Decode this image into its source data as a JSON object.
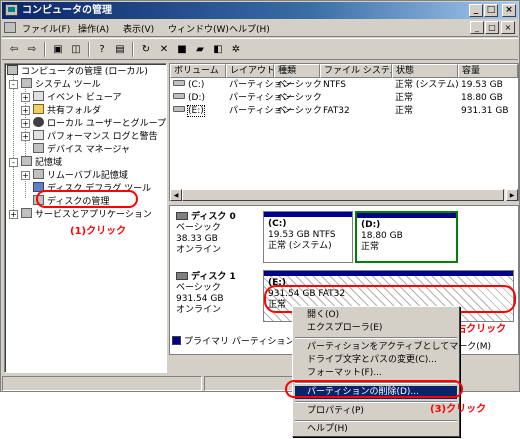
{
  "window": {
    "title": "コンピュータの管理"
  },
  "titlebar_buttons": [
    "_",
    "□",
    "×"
  ],
  "menubar": {
    "items": [
      "ファイル(F)",
      "操作(A)",
      "表示(V)",
      "ウィンドウ(W)",
      "ヘルプ(H)"
    ],
    "mdi_buttons": [
      "_",
      "□",
      "×"
    ]
  },
  "toolbar": {
    "icons": [
      "back-arrow-icon",
      "forward-arrow-icon",
      "up-folder-icon",
      "show-tree-icon",
      "help-icon",
      "properties-icon",
      "refresh-icon",
      "delete-icon",
      "open-icon",
      "folder-icon",
      "drive-icon",
      "settings-icon"
    ]
  },
  "tree": {
    "root": "コンピュータの管理 (ローカル)",
    "system_tools": "システム ツール",
    "event_viewer": "イベント ビューア",
    "shared_folders": "共有フォルダ",
    "local_users": "ローカル ユーザーとグループ",
    "perf_logs": "パフォーマンス ログと警告",
    "device_manager": "デバイス マネージャ",
    "storage": "記憶域",
    "removable": "リムーバブル記憶域",
    "defrag": "ディスク デフラグ ツール",
    "disk_mgmt": "ディスクの管理",
    "services_apps": "サービスとアプリケーション",
    "expander_plus": "+",
    "expander_minus": "-"
  },
  "volumes": {
    "columns": [
      "ボリューム",
      "レイアウト",
      "種類",
      "ファイル システム",
      "状態",
      "容量"
    ],
    "rows": [
      [
        "(C:)",
        "パーティション",
        "ベーシック",
        "NTFS",
        "正常 (システム)",
        "19.53 GB"
      ],
      [
        "(D:)",
        "パーティション",
        "ベーシック",
        "",
        "正常",
        "18.80 GB"
      ],
      [
        "(E:)",
        "パーティション",
        "ベーシック",
        "FAT32",
        "正常",
        "931.31 GB"
      ]
    ]
  },
  "disk0": {
    "name": "ディスク 0",
    "type": "ベーシック",
    "size": "38.33 GB",
    "status": "オンライン",
    "partitions": [
      {
        "letter": "(C:)",
        "size": "19.53 GB NTFS",
        "status": "正常 (システム)"
      },
      {
        "letter": "(D:)",
        "size": "18.80 GB",
        "status": "正常"
      }
    ]
  },
  "disk1": {
    "name": "ディスク 1",
    "type": "ベーシック",
    "size": "931.54 GB",
    "status": "オンライン",
    "partition": {
      "letter": "(E:)",
      "size": "931.54 GB FAT32",
      "status": "正常"
    }
  },
  "legend": {
    "primary": "プライマリ パーティション"
  },
  "context_menu": {
    "open": "開く(O)",
    "explore": "エクスプローラ(E)",
    "activate": "パーティションをアクティブとしてマーク(M)",
    "change_letter": "ドライブ文字とパスの変更(C)...",
    "format": "フォーマット(F)...",
    "delete": "パーティションの削除(D)...",
    "properties": "プロパティ(P)",
    "help": "ヘルプ(H)"
  },
  "annotations": {
    "step1": "(1)クリック",
    "step2": "(2)右クリック",
    "step3": "(3)クリック"
  },
  "colors": {
    "title_start": "#0a246a",
    "title_end": "#a6caf0",
    "primary_partition": "#00008b",
    "selected_partition_border": "#008000",
    "annotation": "#ff0000",
    "menu_highlight": "#0a246a"
  }
}
